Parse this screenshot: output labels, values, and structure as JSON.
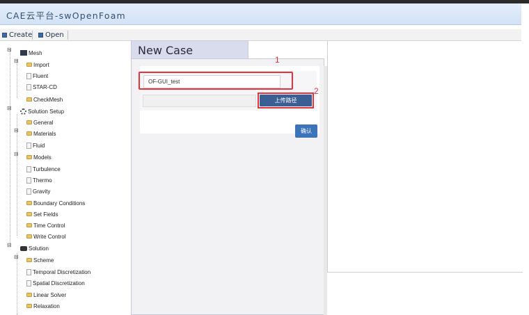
{
  "app": {
    "title": "CAE云平台-swOpenFoam"
  },
  "toolbar": {
    "create_label": "Create",
    "open_label": "Open"
  },
  "tree": {
    "mesh": {
      "label": "Mesh",
      "import": "Import",
      "fluent": "Fluent",
      "starcd": "STAR-CD",
      "checkmesh": "CheckMesh"
    },
    "setup": {
      "label": "Solution Setup",
      "general": "General",
      "materials": "Materials",
      "fluid": "Fluid",
      "models": "Models",
      "turbulence": "Turbulence",
      "thermo": "Thermo",
      "gravity": "Gravity",
      "boundary": "Boundary Conditions",
      "setfields": "Set Fields",
      "timecontrol": "Time Control",
      "writecontrol": "Write Control"
    },
    "solution": {
      "label": "Solution",
      "scheme": "Scheme",
      "temporal": "Temporal Discretization",
      "spatial": "Spatial Discretization",
      "linear": "Linear Solver",
      "relaxation": "Relaxation"
    }
  },
  "newcase": {
    "title": "New Case",
    "case_name_value": "OF-GUI_test",
    "upload_label": "上传路径",
    "confirm_label": "确认",
    "annotation_1": "1",
    "annotation_2": "2"
  },
  "colors": {
    "annotation_red": "#e5333b",
    "upload_button": "#3b5f94",
    "confirm_button": "#3d73b8"
  }
}
